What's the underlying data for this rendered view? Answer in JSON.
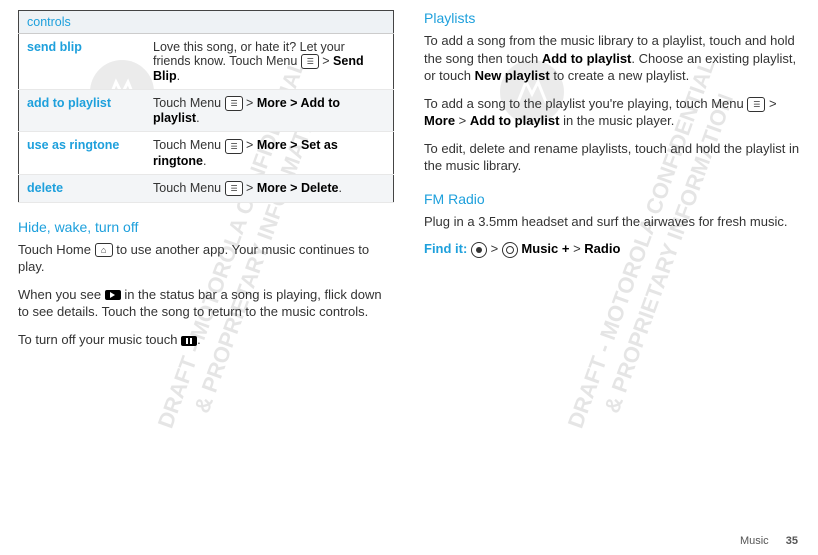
{
  "left": {
    "table_header": "controls",
    "rows": [
      {
        "name": "send blip",
        "desc_parts": [
          "Love this song, or hate it? Let your friends know. Touch Menu ",
          " > ",
          "Send Blip",
          "."
        ]
      },
      {
        "name": "add to playlist",
        "desc_parts": [
          "Touch Menu ",
          " > ",
          "More > Add to playlist",
          "."
        ]
      },
      {
        "name": "use as ringtone",
        "desc_parts": [
          "Touch Menu ",
          " > ",
          "More > Set as ringtone",
          "."
        ]
      },
      {
        "name": "delete",
        "desc_parts": [
          "Touch Menu ",
          " > ",
          "More > Delete",
          "."
        ]
      }
    ],
    "section_hide": "Hide, wake, turn off",
    "p1_a": "Touch Home ",
    "p1_b": " to use another app. Your music continues to play.",
    "p2_a": "When you see ",
    "p2_b": " in the status bar a song is playing, flick down to see details. Touch the song to return to the music controls.",
    "p3_a": "To turn off your music touch ",
    "p3_b": "."
  },
  "right": {
    "section_playlists": "Playlists",
    "pl_p1_a": "To add a song from the music library to a playlist, touch and hold the song then touch ",
    "pl_p1_b": "Add to playlist",
    "pl_p1_c": ". Choose an existing playlist, or touch ",
    "pl_p1_d": "New playlist",
    "pl_p1_e": " to create a new playlist.",
    "pl_p2_a": "To add a song to the playlist you're playing, touch Menu ",
    "pl_p2_b": " > ",
    "pl_p2_c": "More",
    "pl_p2_d": " > ",
    "pl_p2_e": "Add to playlist",
    "pl_p2_f": " in the music player.",
    "pl_p3": "To edit, delete and rename playlists, touch and hold the playlist in the music library.",
    "section_fm": "FM Radio",
    "fm_p1": "Plug in a 3.5mm headset and surf the airwaves for fresh music.",
    "findit_label": "Find it:",
    "findit_a": " > ",
    "findit_b": "Music +",
    "findit_c": " > ",
    "findit_d": "Radio"
  },
  "watermark": "DRAFT - MOTOROLA CONFIDENTIAL\n& PROPRIETARY INFORMATION",
  "footer": {
    "section": "Music",
    "page": "35"
  }
}
